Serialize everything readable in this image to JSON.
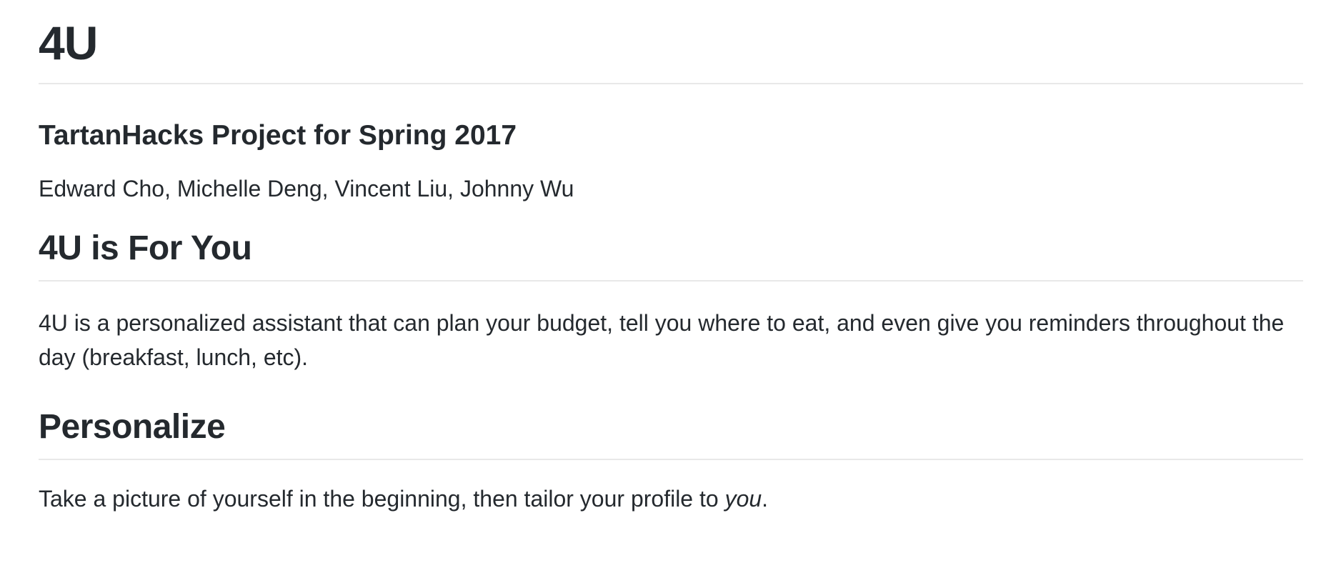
{
  "readme": {
    "title": "4U",
    "subtitle": "TartanHacks Project for Spring 2017",
    "authors": "Edward Cho, Michelle Deng, Vincent Liu, Johnny Wu",
    "sections": [
      {
        "heading": "4U is For You",
        "text": "4U is a personalized assistant that can plan your budget, tell you where to eat, and even give you reminders throughout the day (breakfast, lunch, etc)."
      },
      {
        "heading": "Personalize",
        "text_before": "Take a picture of yourself in the beginning, then tailor your profile to ",
        "text_emphasis": "you",
        "text_after": "."
      }
    ]
  }
}
